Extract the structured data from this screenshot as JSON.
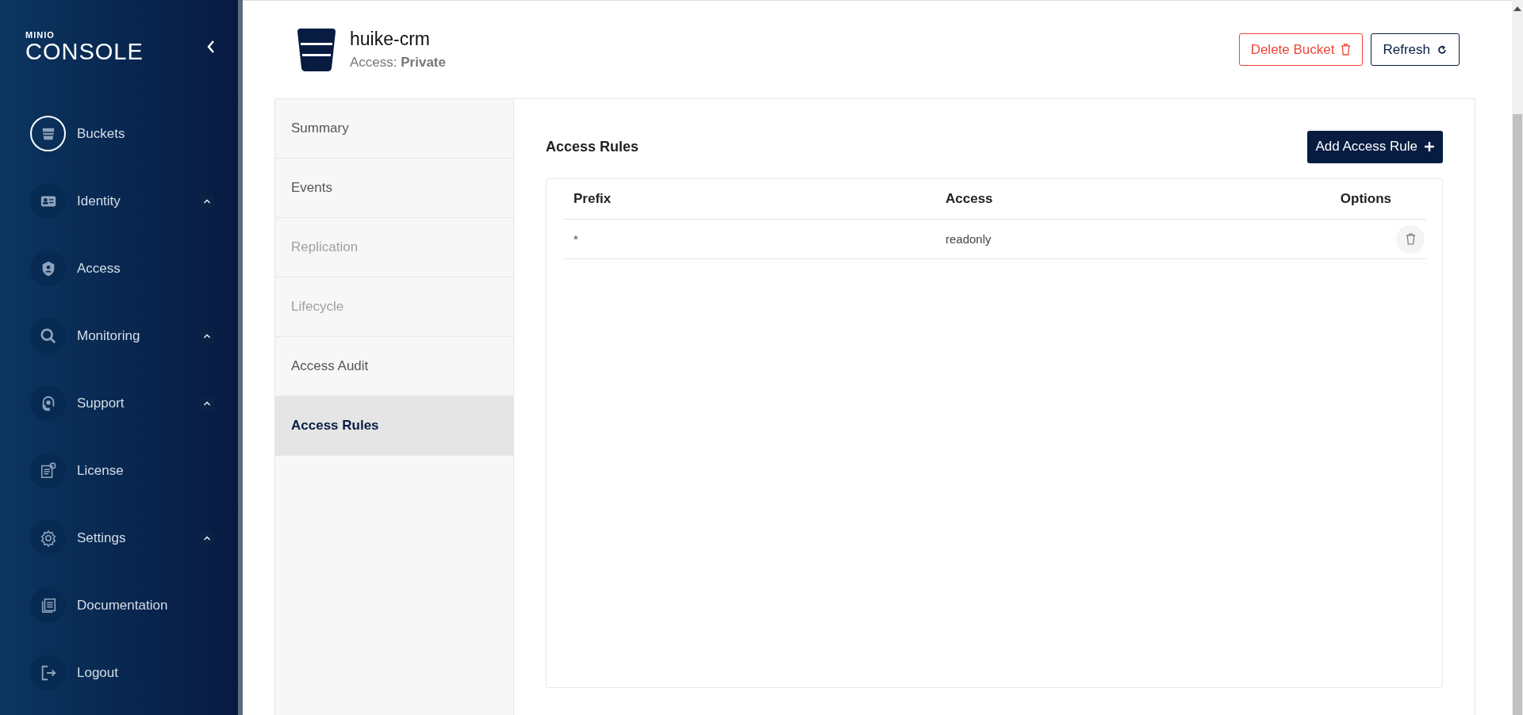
{
  "sidebar": {
    "logo": {
      "brand": "MINIO",
      "product": "CONSOLE"
    },
    "items": [
      {
        "label": "Buckets",
        "selected": true,
        "kind": "link"
      },
      {
        "label": "Identity",
        "selected": false,
        "kind": "group"
      },
      {
        "label": "Access",
        "selected": false,
        "kind": "link"
      },
      {
        "label": "Monitoring",
        "selected": false,
        "kind": "group"
      },
      {
        "label": "Support",
        "selected": false,
        "kind": "group"
      },
      {
        "label": "License",
        "selected": false,
        "kind": "link"
      },
      {
        "label": "Settings",
        "selected": false,
        "kind": "group"
      },
      {
        "label": "Documentation",
        "selected": false,
        "kind": "link"
      },
      {
        "label": "Logout",
        "selected": false,
        "kind": "link"
      }
    ]
  },
  "bucket": {
    "name": "huike-crm",
    "access_label": "Access:",
    "access_value": "Private"
  },
  "actions": [
    {
      "label": "Delete Bucket",
      "kind": "danger"
    },
    {
      "label": "Refresh",
      "kind": "outline"
    }
  ],
  "tabs": [
    {
      "label": "Summary",
      "selected": false,
      "disabled": false
    },
    {
      "label": "Events",
      "selected": false,
      "disabled": false
    },
    {
      "label": "Replication",
      "selected": false,
      "disabled": true
    },
    {
      "label": "Lifecycle",
      "selected": false,
      "disabled": true
    },
    {
      "label": "Access Audit",
      "selected": false,
      "disabled": false
    },
    {
      "label": "Access Rules",
      "selected": true,
      "disabled": false
    }
  ],
  "access_rules": {
    "title": "Access Rules",
    "add_button": "Add Access Rule",
    "table": {
      "columns": [
        "Prefix",
        "Access",
        "Options"
      ],
      "rows": [
        {
          "prefix": "*",
          "access": "readonly"
        }
      ]
    }
  }
}
